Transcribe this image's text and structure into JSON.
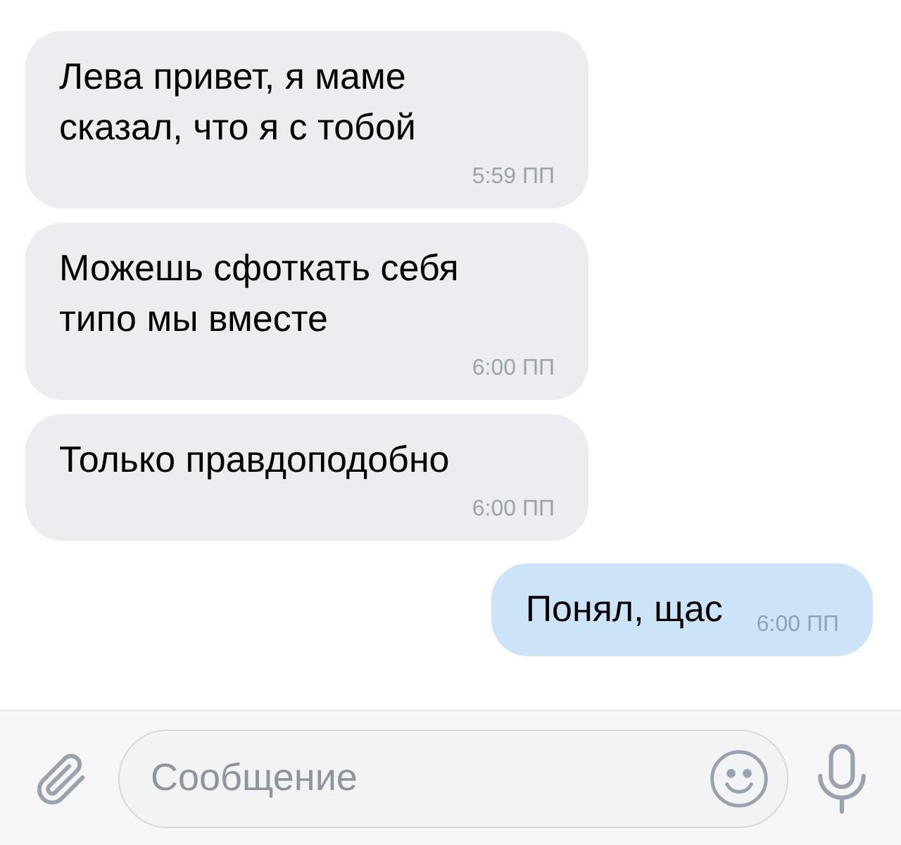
{
  "messages": [
    {
      "kind": "incoming",
      "text": "Лева привет, я маме сказал, что я с тобой",
      "time": "5:59 ПП"
    },
    {
      "kind": "incoming",
      "text": "Можешь сфоткать себя типо мы вместе",
      "time": "6:00 ПП"
    },
    {
      "kind": "incoming",
      "text": "Только правдоподобно",
      "time": "6:00 ПП"
    },
    {
      "kind": "outgoing",
      "text": "Понял, щас",
      "time": "6:00 ПП"
    }
  ],
  "composer": {
    "placeholder": "Сообщение"
  }
}
